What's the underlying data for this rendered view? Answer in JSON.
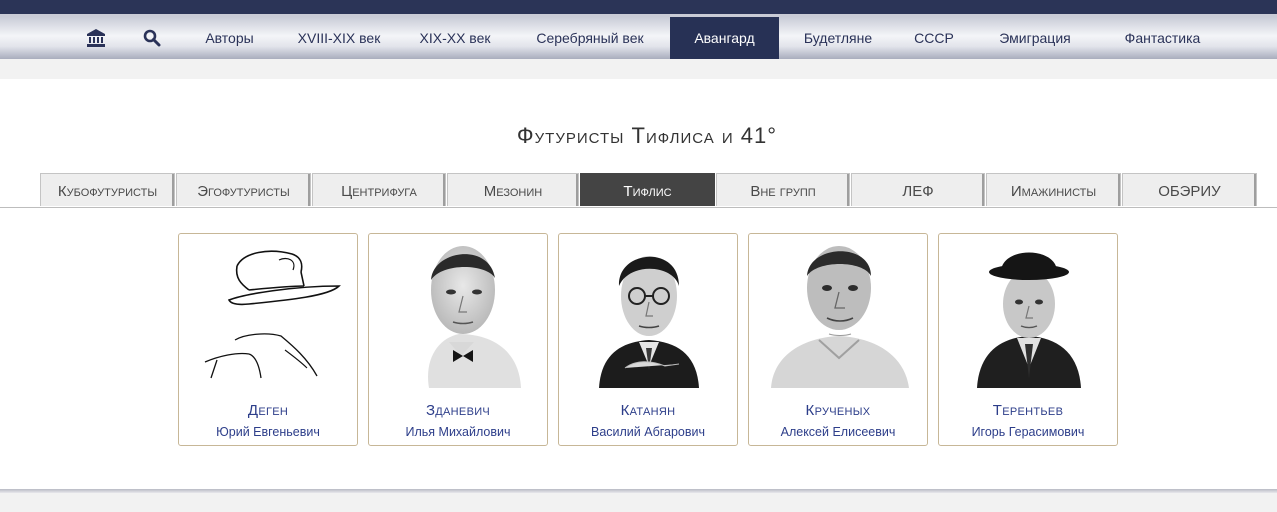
{
  "nav": {
    "items": [
      "Авторы",
      "XVIII-XIX век",
      "XIX-XX век",
      "Серебряный век",
      "Авангард",
      "Будетляне",
      "СССР",
      "Эмиграция",
      "Фантастика"
    ],
    "active": "Авангард",
    "icons": [
      "museum-icon",
      "search-icon"
    ]
  },
  "page": {
    "title": "Футуристы Тифлиса и 41°"
  },
  "tabs": {
    "items": [
      "Кубофутуристы",
      "Эгофутуристы",
      "Центрифуга",
      "Мезонин",
      "Тифлис",
      "Вне групп",
      "ЛЕФ",
      "Имажинисты",
      "ОБЭРИУ"
    ],
    "active": "Тифлис"
  },
  "authors": [
    {
      "surname": "Деген",
      "name": "Юрий Евгеньевич",
      "portrait": "hat-outline-placeholder"
    },
    {
      "surname": "Зданевич",
      "name": "Илья Михайлович",
      "portrait": "photo"
    },
    {
      "surname": "Катанян",
      "name": "Василий Абгарович",
      "portrait": "photo"
    },
    {
      "surname": "Крученых",
      "name": "Алексей Елисеевич",
      "portrait": "photo"
    },
    {
      "surname": "Терентьев",
      "name": "Игорь Герасимович",
      "portrait": "photo"
    }
  ],
  "colors": {
    "nav_dark": "#2b3457",
    "nav_text": "#2a3258",
    "active_tab": "#444444",
    "link": "#2d3e8a",
    "card_border": "#c7b797"
  }
}
